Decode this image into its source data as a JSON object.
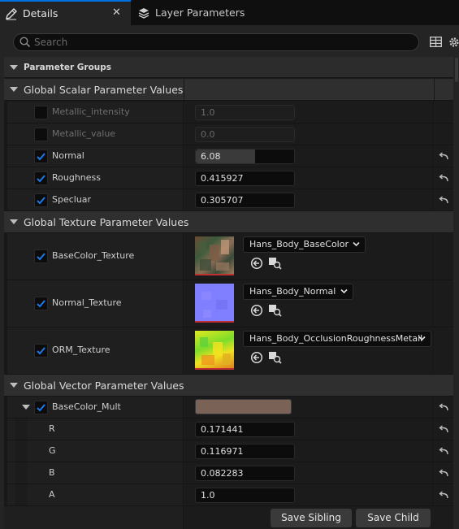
{
  "tabs": {
    "details": "Details",
    "layer_parameters": "Layer Parameters",
    "close_glyph": "✕"
  },
  "search": {
    "placeholder": "Search"
  },
  "parameter_groups": "Parameter Groups",
  "scalar": {
    "title": "Global Scalar Parameter Values",
    "items": [
      {
        "name": "Metallic_intensity",
        "value": "1.0",
        "enabled": false,
        "fill": 0
      },
      {
        "name": "Metallic_value",
        "value": "0.0",
        "enabled": false,
        "fill": 0
      },
      {
        "name": "Normal",
        "value": "6.08",
        "enabled": true,
        "fill": 0.6
      },
      {
        "name": "Roughness",
        "value": "0.415927",
        "enabled": true,
        "fill": 0
      },
      {
        "name": "Specluar",
        "value": "0.305707",
        "enabled": true,
        "fill": 0
      }
    ]
  },
  "texture": {
    "title": "Global Texture Parameter Values",
    "items": [
      {
        "name": "BaseColor_Texture",
        "asset": "Hans_Body_BaseColor",
        "enabled": true
      },
      {
        "name": "Normal_Texture",
        "asset": "Hans_Body_Normal",
        "enabled": true
      },
      {
        "name": "ORM_Texture",
        "asset": "Hans_Body_OcclusionRoughnessMetall",
        "enabled": true
      }
    ]
  },
  "vector": {
    "title": "Global Vector Parameter Values",
    "param": {
      "name": "BaseColor_Mult",
      "color": "#7a6356",
      "enabled": true,
      "channels": [
        {
          "name": "R",
          "value": "0.171441"
        },
        {
          "name": "G",
          "value": "0.116971"
        },
        {
          "name": "B",
          "value": "0.082283"
        },
        {
          "name": "A",
          "value": "1.0"
        }
      ]
    }
  },
  "buttons": {
    "save_sibling": "Save Sibling",
    "save_child": "Save Child"
  },
  "colors": {
    "accent": "#0070e0",
    "checkbox_on": "#1f6fd6"
  }
}
